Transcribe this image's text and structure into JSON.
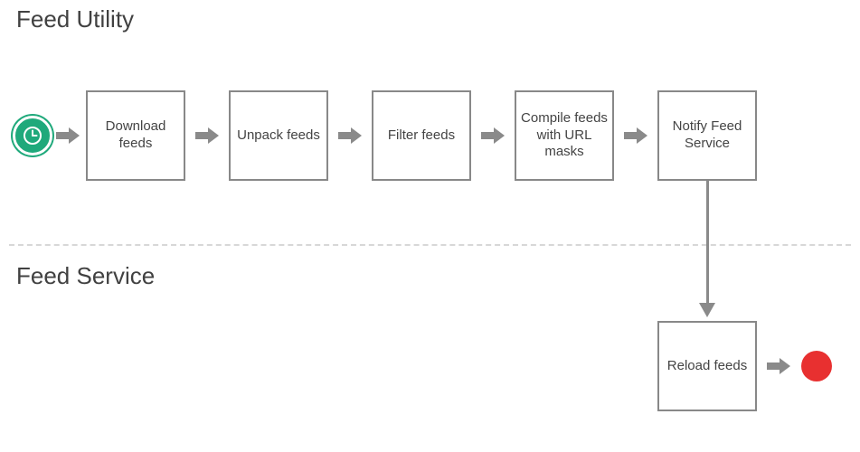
{
  "diagram": {
    "sections": {
      "top": "Feed Utility",
      "bottom": "Feed Service"
    },
    "steps_top": [
      "Download feeds",
      "Unpack feeds",
      "Filter feeds",
      "Compile feeds with URL masks",
      "Notify Feed Service"
    ],
    "step_bottom": "Reload feeds",
    "start_node": "clock",
    "end_node": "terminator",
    "colors": {
      "box_border": "#888888",
      "arrow": "#8a8a8a",
      "start_badge": "#1fa97b",
      "end_dot": "#e83030",
      "section_text": "#414141"
    }
  }
}
